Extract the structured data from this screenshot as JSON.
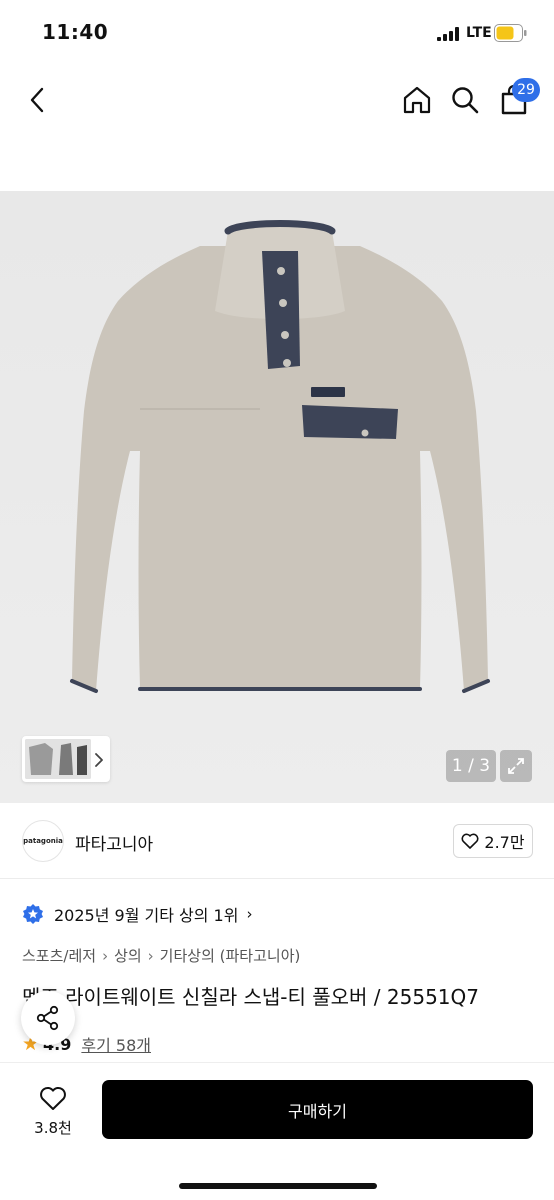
{
  "status_bar": {
    "time": "11:40",
    "network": "LTE",
    "battery_color": "#f5c518"
  },
  "nav": {
    "back_icon": "chevron-left-icon",
    "home_icon": "home-icon",
    "search_icon": "search-icon",
    "cart_icon": "cart-icon",
    "cart_count": "29",
    "badge_color": "#2f6fe8"
  },
  "gallery": {
    "page_counter": "1 / 3",
    "expand_icon": "expand-icon",
    "thumb_chevron_icon": "chevron-right-icon",
    "fleece_color": "#cbc5bb",
    "trim_color": "#3d4457"
  },
  "brand": {
    "logo_text": "patagonia",
    "name": "파타고니아",
    "like_count": "2.7만"
  },
  "ranking": {
    "text": "2025년 9월 기타 상의 1위",
    "icon": "badge-star-icon",
    "chevron": "›"
  },
  "breadcrumb": {
    "items": [
      "스포츠/레저",
      "상의",
      "기타상의 (파타고니아)"
    ],
    "separator": "›"
  },
  "product": {
    "title": "멘즈 라이트웨이트 신칠라 스냅-티 풀오버 / 25551Q7",
    "rating": "4.9",
    "reviews": "후기 58개",
    "star": "★"
  },
  "share": {
    "icon": "share-icon"
  },
  "bottom_bar": {
    "wish_count": "3.8천",
    "heart_icon": "heart-icon",
    "buy_label": "구매하기"
  }
}
